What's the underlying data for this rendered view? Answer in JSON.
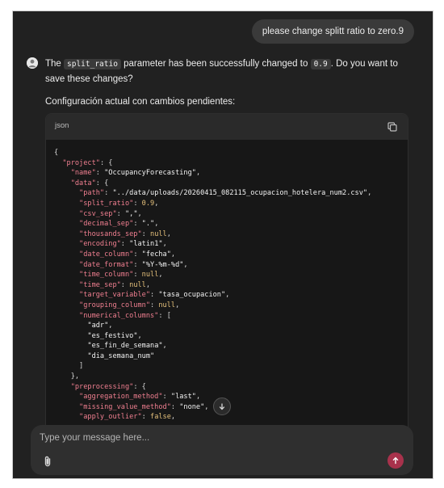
{
  "chat": {
    "user_message": "please change splitt ratio to zero.9",
    "bot_message": {
      "part1": "The ",
      "code1": "split_ratio",
      "part2": " parameter has been successfully changed to ",
      "code2": "0.9",
      "part3": ". Do you want to save these changes?"
    },
    "sub_heading": "Configuración actual con cambios pendientes:"
  },
  "code_block": {
    "language": "json",
    "copy_icon": "copy-icon",
    "lines": [
      [
        [
          "p",
          "{"
        ]
      ],
      [
        [
          "p",
          "  "
        ],
        [
          "k",
          "\"project\""
        ],
        [
          "p",
          ": {"
        ]
      ],
      [
        [
          "p",
          "    "
        ],
        [
          "k",
          "\"name\""
        ],
        [
          "p",
          ": "
        ],
        [
          "s",
          "\"OccupancyForecasting\""
        ],
        [
          "p",
          ","
        ]
      ],
      [
        [
          "p",
          "    "
        ],
        [
          "k",
          "\"data\""
        ],
        [
          "p",
          ": {"
        ]
      ],
      [
        [
          "p",
          "      "
        ],
        [
          "k",
          "\"path\""
        ],
        [
          "p",
          ": "
        ],
        [
          "s",
          "\"../data/uploads/20260415_082115_ocupacion_hotelera_num2.csv\""
        ],
        [
          "p",
          ","
        ]
      ],
      [
        [
          "p",
          "      "
        ],
        [
          "k",
          "\"split_ratio\""
        ],
        [
          "p",
          ": "
        ],
        [
          "n",
          "0.9"
        ],
        [
          "p",
          ","
        ]
      ],
      [
        [
          "p",
          "      "
        ],
        [
          "k",
          "\"csv_sep\""
        ],
        [
          "p",
          ": "
        ],
        [
          "s",
          "\",\""
        ],
        [
          "p",
          ","
        ]
      ],
      [
        [
          "p",
          "      "
        ],
        [
          "k",
          "\"decimal_sep\""
        ],
        [
          "p",
          ": "
        ],
        [
          "s",
          "\".\""
        ],
        [
          "p",
          ","
        ]
      ],
      [
        [
          "p",
          "      "
        ],
        [
          "k",
          "\"thousands_sep\""
        ],
        [
          "p",
          ": "
        ],
        [
          "n",
          "null"
        ],
        [
          "p",
          ","
        ]
      ],
      [
        [
          "p",
          "      "
        ],
        [
          "k",
          "\"encoding\""
        ],
        [
          "p",
          ": "
        ],
        [
          "s",
          "\"latin1\""
        ],
        [
          "p",
          ","
        ]
      ],
      [
        [
          "p",
          "      "
        ],
        [
          "k",
          "\"date_column\""
        ],
        [
          "p",
          ": "
        ],
        [
          "s",
          "\"fecha\""
        ],
        [
          "p",
          ","
        ]
      ],
      [
        [
          "p",
          "      "
        ],
        [
          "k",
          "\"date_format\""
        ],
        [
          "p",
          ": "
        ],
        [
          "s",
          "\"%Y-%m-%d\""
        ],
        [
          "p",
          ","
        ]
      ],
      [
        [
          "p",
          "      "
        ],
        [
          "k",
          "\"time_column\""
        ],
        [
          "p",
          ": "
        ],
        [
          "n",
          "null"
        ],
        [
          "p",
          ","
        ]
      ],
      [
        [
          "p",
          "      "
        ],
        [
          "k",
          "\"time_sep\""
        ],
        [
          "p",
          ": "
        ],
        [
          "n",
          "null"
        ],
        [
          "p",
          ","
        ]
      ],
      [
        [
          "p",
          "      "
        ],
        [
          "k",
          "\"target_variable\""
        ],
        [
          "p",
          ": "
        ],
        [
          "s",
          "\"tasa_ocupacion\""
        ],
        [
          "p",
          ","
        ]
      ],
      [
        [
          "p",
          "      "
        ],
        [
          "k",
          "\"grouping_column\""
        ],
        [
          "p",
          ": "
        ],
        [
          "n",
          "null"
        ],
        [
          "p",
          ","
        ]
      ],
      [
        [
          "p",
          "      "
        ],
        [
          "k",
          "\"numerical_columns\""
        ],
        [
          "p",
          ": ["
        ]
      ],
      [
        [
          "p",
          "        "
        ],
        [
          "s",
          "\"adr\""
        ],
        [
          "p",
          ","
        ]
      ],
      [
        [
          "p",
          "        "
        ],
        [
          "s",
          "\"es_festivo\""
        ],
        [
          "p",
          ","
        ]
      ],
      [
        [
          "p",
          "        "
        ],
        [
          "s",
          "\"es_fin_de_semana\""
        ],
        [
          "p",
          ","
        ]
      ],
      [
        [
          "p",
          "        "
        ],
        [
          "s",
          "\"dia_semana_num\""
        ]
      ],
      [
        [
          "p",
          "      ]"
        ]
      ],
      [
        [
          "p",
          "    },"
        ]
      ],
      [
        [
          "p",
          "    "
        ],
        [
          "k",
          "\"preprocessing\""
        ],
        [
          "p",
          ": {"
        ]
      ],
      [
        [
          "p",
          "      "
        ],
        [
          "k",
          "\"aggregation_method\""
        ],
        [
          "p",
          ": "
        ],
        [
          "s",
          "\"last\""
        ],
        [
          "p",
          ","
        ]
      ],
      [
        [
          "p",
          "      "
        ],
        [
          "k",
          "\"missing_value_method\""
        ],
        [
          "p",
          ": "
        ],
        [
          "s",
          "\"none\""
        ],
        [
          "p",
          ","
        ]
      ],
      [
        [
          "p",
          "      "
        ],
        [
          "k",
          "\"apply_outlier\""
        ],
        [
          "p",
          ": "
        ],
        [
          "n",
          "false"
        ],
        [
          "p",
          ","
        ]
      ]
    ]
  },
  "composer": {
    "placeholder": "Type your message here...",
    "attach_icon": "paperclip-icon",
    "send_icon": "arrow-up-icon"
  },
  "colors": {
    "background": "#212121",
    "code_background": "#171717",
    "key": "#f07f90",
    "string": "#f2f2f2",
    "literal": "#e5c07b",
    "send_button": "#a8324c"
  }
}
